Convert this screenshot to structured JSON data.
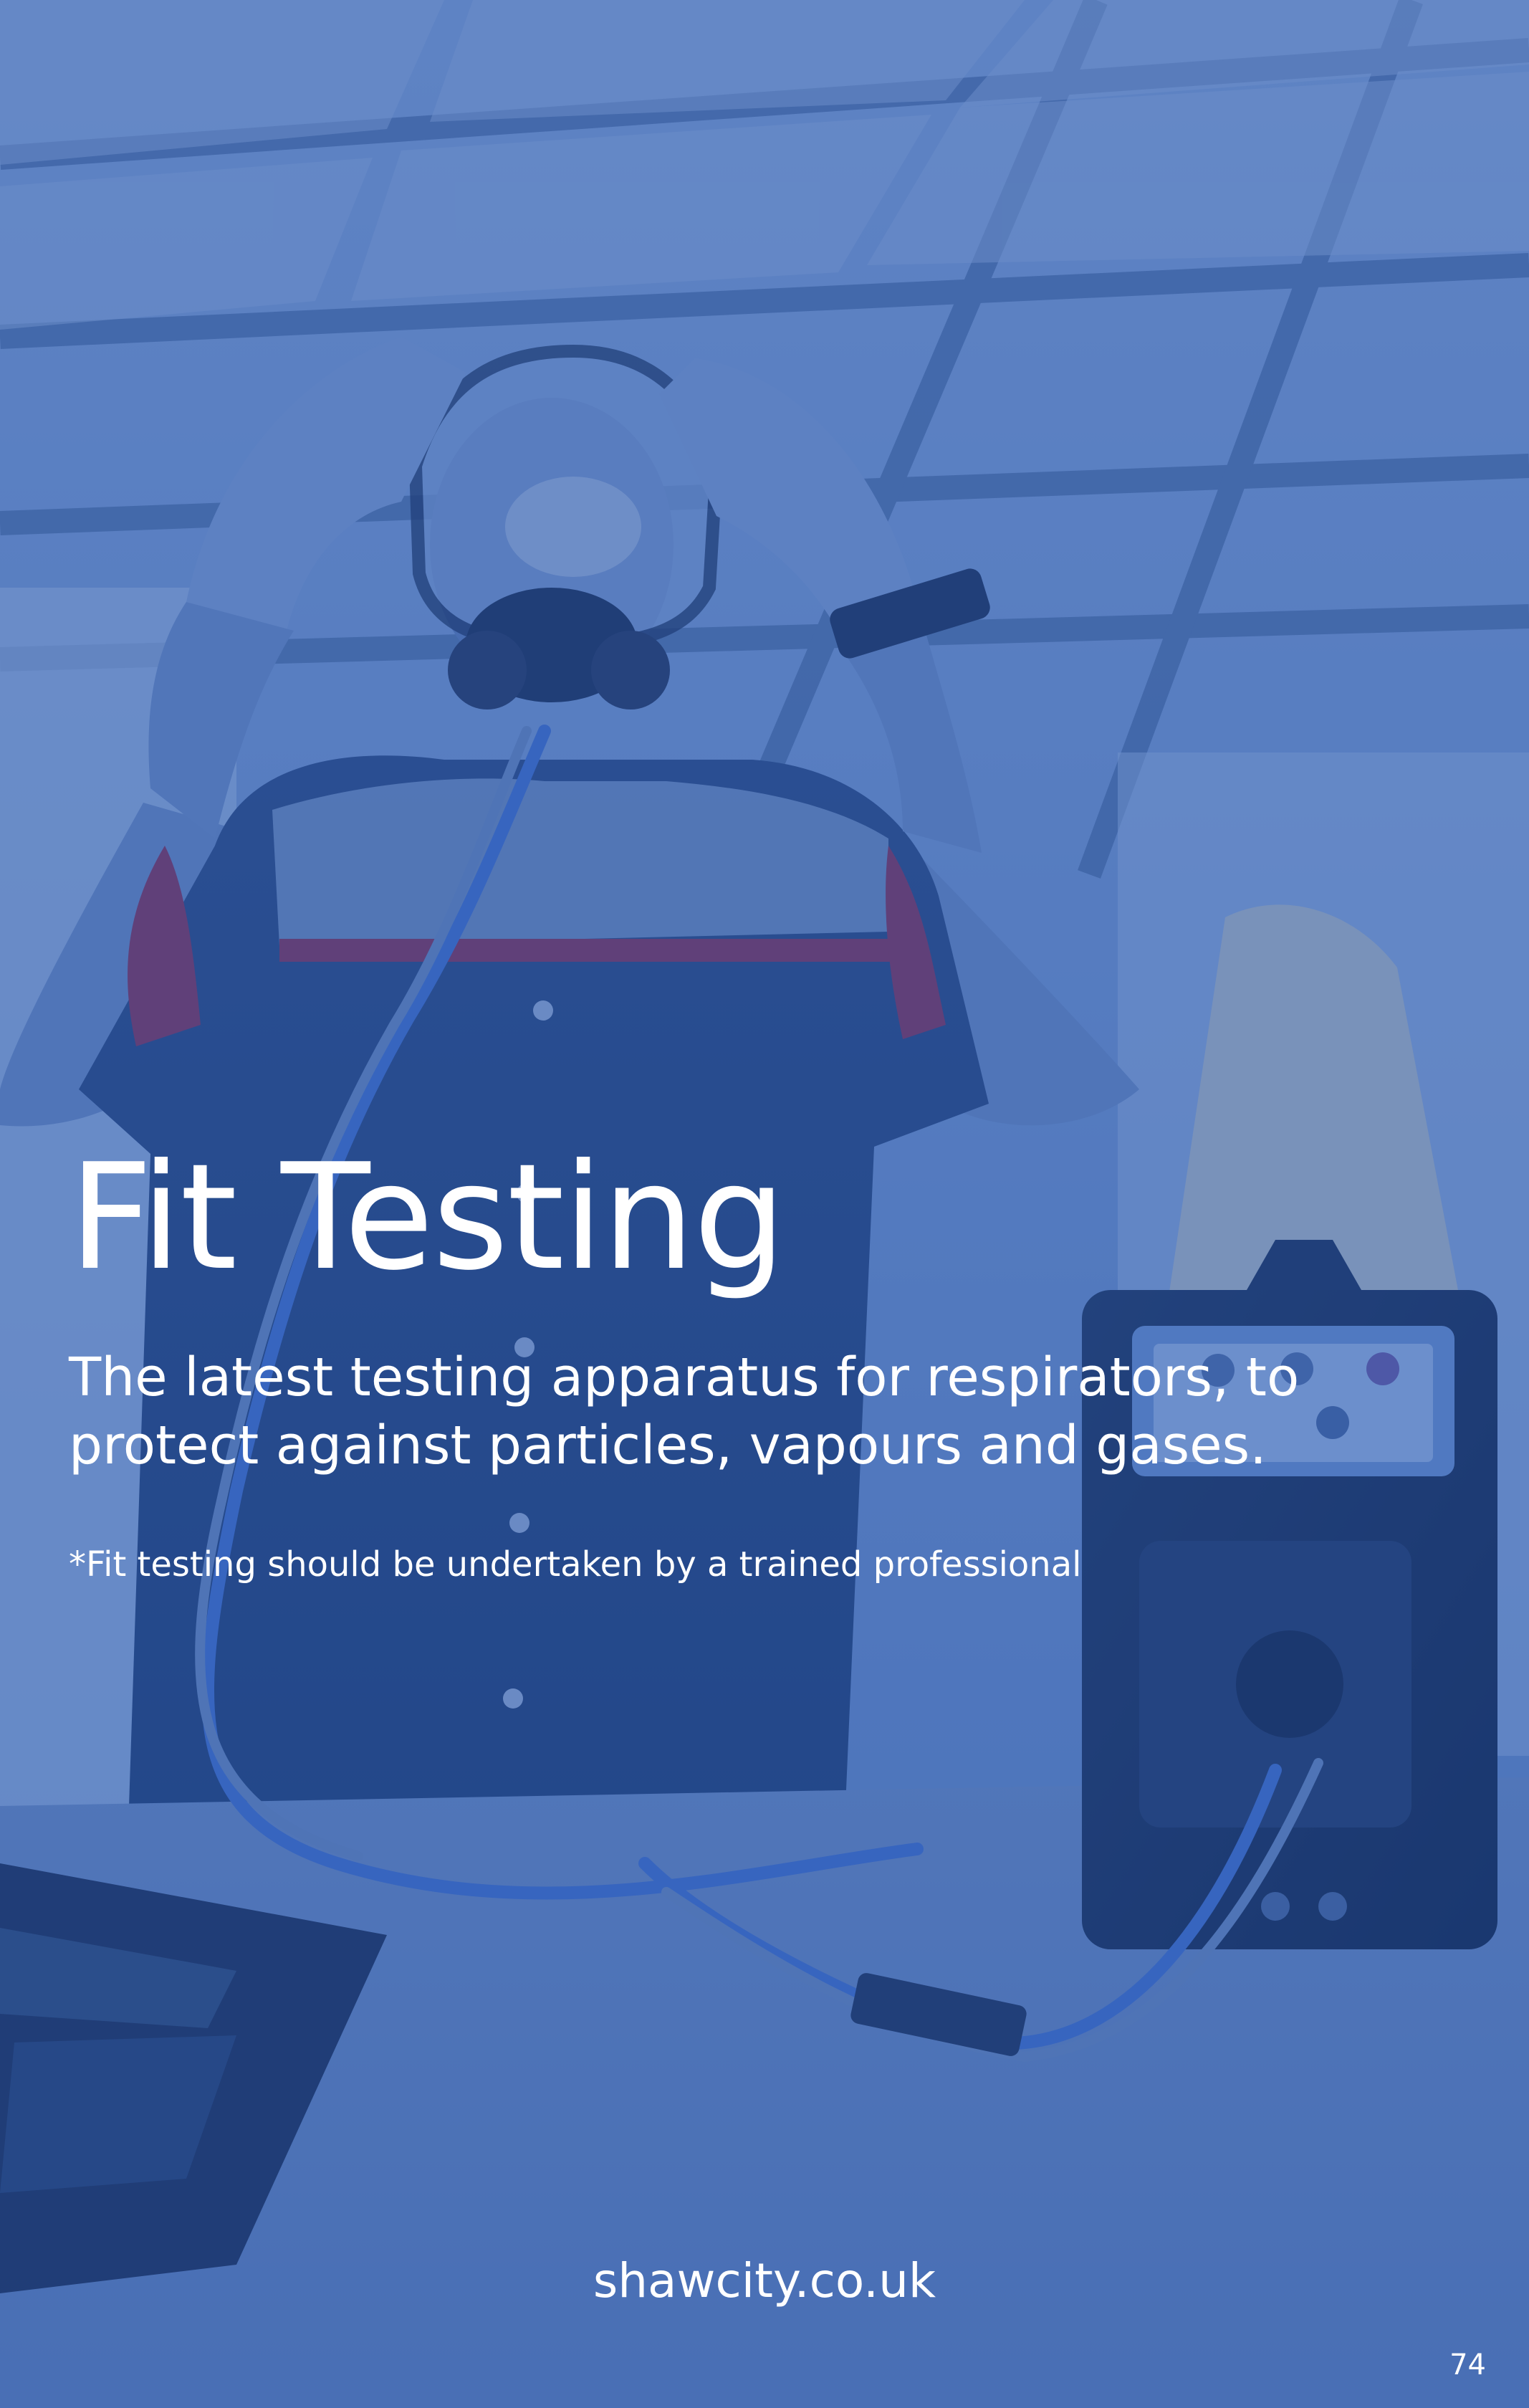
{
  "page": {
    "title": "Fit Testing",
    "subtitle": "The latest testing apparatus for respirators, to protect against particles, vapours and gases.",
    "note": "*Fit testing should be undertaken by a trained professional",
    "website": "shawcity.co.uk",
    "page_number": "74"
  },
  "colors": {
    "overlay": "#2756aa",
    "text": "#ffffff"
  }
}
